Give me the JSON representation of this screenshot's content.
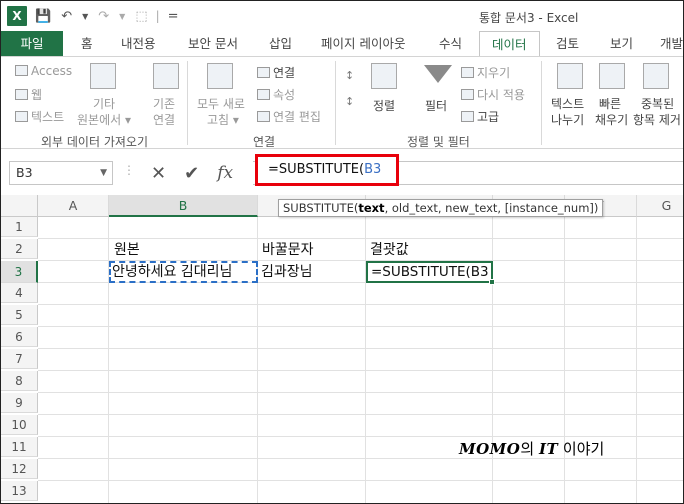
{
  "titlebar": {
    "app_icon_text": "X",
    "qat_separator": "|",
    "qat_more": "=",
    "title": "통합 문서3 - Excel"
  },
  "tabs": {
    "file": "파일",
    "items": [
      "홈",
      "내전용",
      "보안 문서",
      "삽입",
      "페이지 레이아웃",
      "수식",
      "데이터",
      "검토",
      "보기",
      "개발"
    ],
    "active": "데이터"
  },
  "ribbon": {
    "external": {
      "access": "Access",
      "web": "웹",
      "text": "텍스트",
      "other_line1": "기타",
      "other_line2": "원본에서 ▾",
      "existing_line1": "기존",
      "existing_line2": "연결",
      "label": "외부 데이터 가져오기"
    },
    "connections": {
      "refresh_line1": "모두 새로",
      "refresh_line2": "고침 ▾",
      "connections": "연결",
      "properties": "속성",
      "edit_links": "연결 편집",
      "label": "연결"
    },
    "sortfilter": {
      "sort": "정렬",
      "filter": "필터",
      "clear": "지우기",
      "reapply": "다시 적용",
      "advanced": "고급",
      "label": "정렬 및 필터"
    },
    "tools": {
      "text_to_col_line1": "텍스트",
      "text_to_col_line2": "나누기",
      "flash_line1": "빠른",
      "flash_line2": "채우기",
      "dup_line1": "중복된",
      "dup_line2": "항목 제거"
    }
  },
  "formula_bar": {
    "name_box": "B3",
    "formula_prefix": "=SUBSTITUTE(",
    "formula_ref": "B3",
    "fx": "fx"
  },
  "tooltip": {
    "func": "SUBSTITUTE(",
    "arg1": "text",
    "rest": ", old_text, new_text, [instance_num])"
  },
  "grid": {
    "columns": [
      "A",
      "B",
      "C",
      "D",
      "E",
      "F",
      "G"
    ],
    "rows": [
      "1",
      "2",
      "3",
      "4",
      "5",
      "6",
      "7",
      "8",
      "9",
      "10",
      "11",
      "12",
      "13"
    ],
    "cells": {
      "b2": "원본",
      "c2": "바꿀문자",
      "d2": "결괏값",
      "b3": "안녕하세요 김대리님",
      "c3": "김과장님",
      "d3": "=SUBSTITUTE(B3"
    }
  },
  "watermark": {
    "brand": "MOMO",
    "particle": "의",
    "it": "IT",
    "tail": "이야기"
  },
  "colors": {
    "excel_green": "#217346",
    "highlight_red": "#e8000b",
    "reference_blue": "#3a6fc4"
  }
}
